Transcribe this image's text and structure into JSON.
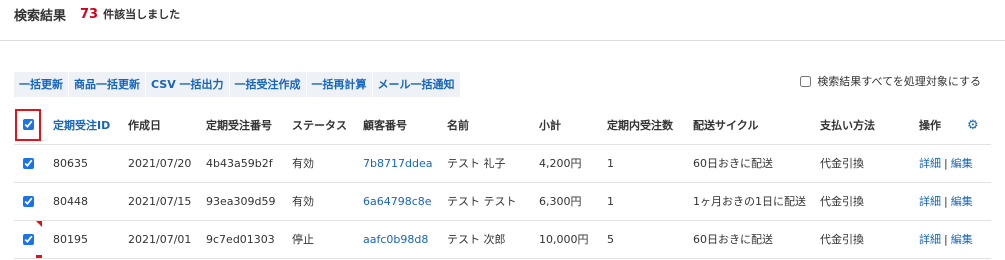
{
  "search_result": {
    "label": "検索結果",
    "count": "73",
    "suffix": "件該当しました"
  },
  "bulk_actions": [
    "一括更新",
    "商品一括更新",
    "CSV 一括出力",
    "一括受注作成",
    "一括再計算",
    "メール一括通知"
  ],
  "select_all_results": {
    "label": "検索結果すべてを処理対象にする",
    "checked": false
  },
  "table": {
    "header_checkbox_checked": true,
    "columns": [
      "定期受注ID",
      "作成日",
      "定期受注番号",
      "ステータス",
      "顧客番号",
      "名前",
      "小計",
      "定期内受注数",
      "配送サイクル",
      "支払い方法",
      "操作"
    ],
    "settings_icon": "gear-icon",
    "rows": [
      {
        "checked": true,
        "id": "80635",
        "created": "2021/07/20",
        "order_no": "4b43a59b2f",
        "status": "有効",
        "customer_no": "7b8717ddea",
        "name": "テスト 礼子",
        "subtotal": "4,200円",
        "count": "1",
        "cycle": "60日おきに配送",
        "payment": "代金引換",
        "detail": "詳細",
        "edit": "編集"
      },
      {
        "checked": true,
        "id": "80448",
        "created": "2021/07/15",
        "order_no": "93ea309d59",
        "status": "有効",
        "customer_no": "6a64798c8e",
        "name": "テスト テスト",
        "subtotal": "6,300円",
        "count": "1",
        "cycle": "1ヶ月おきの1日に配送",
        "payment": "代金引換",
        "detail": "詳細",
        "edit": "編集"
      },
      {
        "checked": true,
        "id": "80195",
        "created": "2021/07/01",
        "order_no": "9c7ed01303",
        "status": "停止",
        "customer_no": "aafc0b98d8",
        "name": "テスト 次郎",
        "subtotal": "10,000円",
        "count": "5",
        "cycle": "60日おきに配送",
        "payment": "代金引換",
        "detail": "詳細",
        "edit": "編集"
      }
    ]
  },
  "colors": {
    "accent": "#1565c0",
    "count": "#d0021b",
    "highlight": "#e0131b"
  }
}
